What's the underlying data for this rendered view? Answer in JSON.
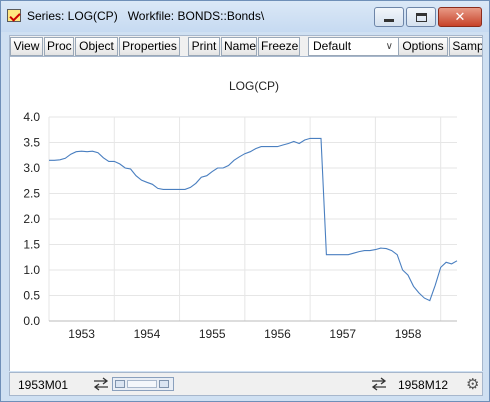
{
  "window": {
    "title": "Series: LOG(CP)   Workfile: BONDS::Bonds\\"
  },
  "toolbar": {
    "buttons": [
      "View",
      "Proc",
      "Object",
      "Properties",
      "Print",
      "Name",
      "Freeze",
      "Options",
      "Samp"
    ],
    "view_select": "Default"
  },
  "statusbar": {
    "start": "1953M01",
    "end": "1958M12"
  },
  "colors": {
    "series_line": "#4a7fc0",
    "gridline": "#e6e6e6"
  },
  "chart_data": {
    "type": "line",
    "title": "LOG(CP)",
    "xlabel": "",
    "ylabel": "",
    "ylim": [
      0.0,
      4.0
    ],
    "yticks": [
      "0.0",
      "0.5",
      "1.0",
      "1.5",
      "2.0",
      "2.5",
      "3.0",
      "3.5",
      "4.0"
    ],
    "xticks": [
      "1953",
      "1954",
      "1955",
      "1956",
      "1957",
      "1958"
    ],
    "grid": true,
    "series": [
      {
        "values": [
          3.15,
          3.15,
          3.16,
          3.19,
          3.27,
          3.32,
          3.33,
          3.32,
          3.33,
          3.3,
          3.2,
          3.13,
          3.13,
          3.08,
          3.0,
          2.98,
          2.85,
          2.76,
          2.72,
          2.68,
          2.6,
          2.58,
          2.58,
          2.58,
          2.58,
          2.58,
          2.62,
          2.7,
          2.82,
          2.85,
          2.93,
          3.0,
          3.0,
          3.05,
          3.15,
          3.22,
          3.28,
          3.32,
          3.38,
          3.42,
          3.42,
          3.42,
          3.42,
          3.45,
          3.48,
          3.52,
          3.48,
          3.55,
          3.58,
          3.58,
          3.58,
          1.3,
          1.3,
          1.3,
          1.3,
          1.3,
          1.33,
          1.36,
          1.38,
          1.38,
          1.4,
          1.43,
          1.42,
          1.38,
          1.3,
          1.0,
          0.9,
          0.68,
          0.55,
          0.45,
          0.4,
          0.7,
          1.05,
          1.15,
          1.12,
          1.18
        ]
      }
    ]
  }
}
